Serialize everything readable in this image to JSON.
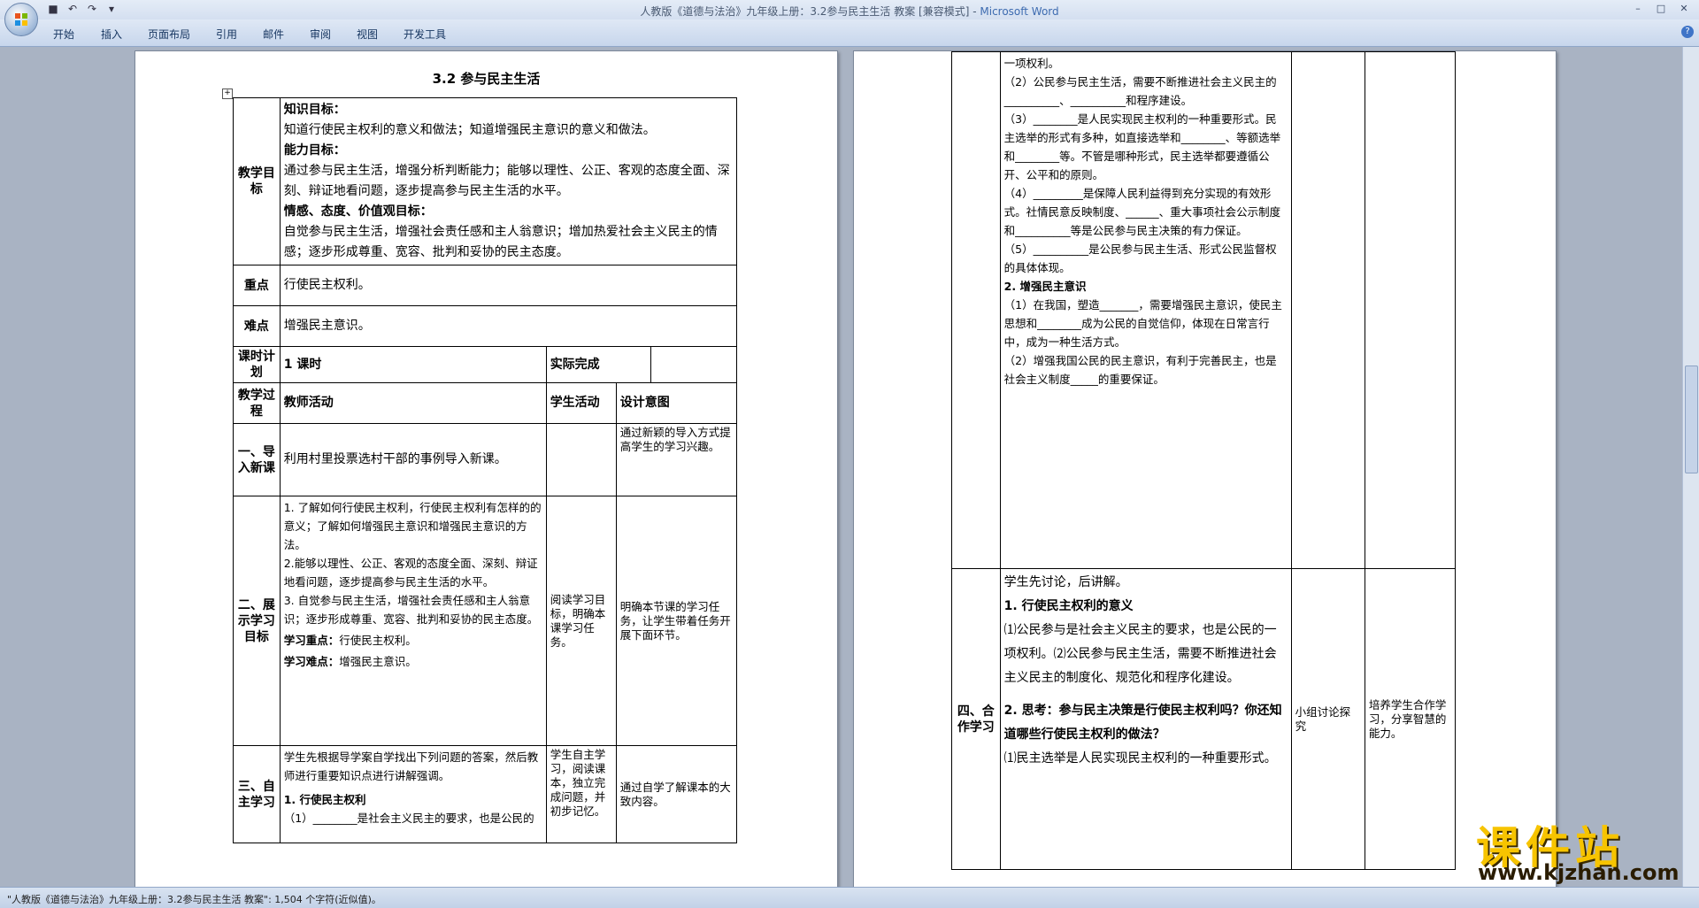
{
  "window": {
    "title": "人教版《道德与法治》九年级上册：3.2参与民主生活 教案 [兼容模式] - ",
    "app": "Microsoft Word",
    "controls": [
      "–",
      "□",
      "✕"
    ]
  },
  "ribbon": {
    "tabs": [
      "开始",
      "插入",
      "页面布局",
      "引用",
      "邮件",
      "审阅",
      "视图",
      "开发工具"
    ]
  },
  "doc": {
    "title": "3.2 参与民主生活"
  },
  "page1": {
    "goals_label": "教学目标",
    "goals": {
      "h1": "知识目标：",
      "t1": "知道行使民主权利的意义和做法；知道增强民主意识的意义和做法。",
      "h2": "能力目标：",
      "t2": "通过参与民主生活，增强分析判断能力；能够以理性、公正、客观的态度全面、深刻、辩证地看问题，逐步提高参与民主生活的水平。",
      "h3": "情感、态度、价值观目标：",
      "t3": "自觉参与民主生活，增强社会责任感和主人翁意识；增加热爱社会主义民主的情感；逐步形成尊重、宽容、批判和妥协的民主态度。"
    },
    "key_label": "重点",
    "key": "行使民主权利。",
    "diff_label": "难点",
    "diff": "增强民主意识。",
    "plan_label": "课时计划",
    "plan": "1 课时",
    "done_label": "实际完成",
    "proc_label": "教学过程",
    "col_teacher": "教师活动",
    "col_student": "学生活动",
    "col_design": "设计意图",
    "s1_label": "一、导入新课",
    "s1_teacher": "利用村里投票选村干部的事例导入新课。",
    "s1_design": "通过新颖的导入方式提高学生的学习兴趣。",
    "s2_label": "二、展示学习目标",
    "s2_t1": "1. 了解如何行使民主权利，行使民主权利有怎样的的意义；了解如何增强民主意识和增强民主意识的方法。",
    "s2_t2": "2.能够以理性、公正、客观的态度全面、深刻、辩证地看问题，逐步提高参与民主生活的水平。",
    "s2_t3": "3. 自觉参与民主生活，增强社会责任感和主人翁意识；逐步形成尊重、宽容、批判和妥协的民主态度。",
    "s2_key_h": "学习重点：",
    "s2_key": "行使民主权利。",
    "s2_diff_h": "学习难点：",
    "s2_diff": "增强民主意识。",
    "s2_student": "阅读学习目标，明确本课学习任务。",
    "s2_design": "明确本节课的学习任务，让学生带着任务开展下面环节。",
    "s3_label": "三、自主学习",
    "s3_t1": "学生先根据导学案自学找出下列问题的答案，然后教师进行重要知识点进行讲解强调。",
    "s3_h": "1. 行使民主权利",
    "s3_t2": "（1）________是社会主义民主的要求，也是公民的",
    "s3_student": "学生自主学习，阅读课本，独立完成问题，并初步记忆。",
    "s3_design": "通过自学了解课本的大致内容。"
  },
  "page2": {
    "p0": "一项权利。",
    "p1": "（2）公民参与民主生活，需要不断推进社会主义民主的__________、__________和程序建设。",
    "p2": "（3）________是人民实现民主权利的一种重要形式。民主选举的形式有多种，如直接选举和________、等额选举和________等。不管是哪种形式，民主选举都要遵循公开、公平和的原则。",
    "p3": "（4）_________是保障人民利益得到充分实现的有效形式。社情民意反映制度、______、重大事项社会公示制度和__________等是公民参与民主决策的有力保证。",
    "p4": "（5）__________是公民参与民主生活、形式公民监督权的具体体现。",
    "h2": "2. 增强民主意识",
    "q1": "（1）在我国，塑造_______，需要增强民主意识，使民主思想和________成为公民的自觉信仰，体现在日常言行中，成为一种生活方式。",
    "q2": "（2）增强我国公民的民主意识，有利于完善民主，也是社会主义制度_____的重要保证。",
    "s4_label": "四、合作学习",
    "s4_t0": "学生先讨论，后讲解。",
    "s4_h1": "1. 行使民主权利的意义",
    "s4_t1": "⑴公民参与是社会主义民主的要求，也是公民的一项权利。⑵公民参与民主生活，需要不断推进社会主义民主的制度化、规范化和程序化建设。",
    "s4_h2": "2. 思考：参与民主决策是行使民主权利吗？你还知道哪些行使民主权利的做法？",
    "s4_t2": "⑴民主选举是人民实现民主权利的一种重要形式。",
    "s4_student": "小组讨论探究",
    "s4_design": "培养学生合作学习，分享智慧的能力。"
  },
  "status": "\"人教版《道德与法治》九年级上册：3.2参与民主生活 教案\": 1,504 个字符(近似值)。",
  "watermark": {
    "brand": "课件站",
    "url": "www.kjzhan.com"
  },
  "colors": {
    "ribbon": "#c7d6ec",
    "page_bg": "#a9b3c3",
    "watermark": "#f7c400"
  }
}
